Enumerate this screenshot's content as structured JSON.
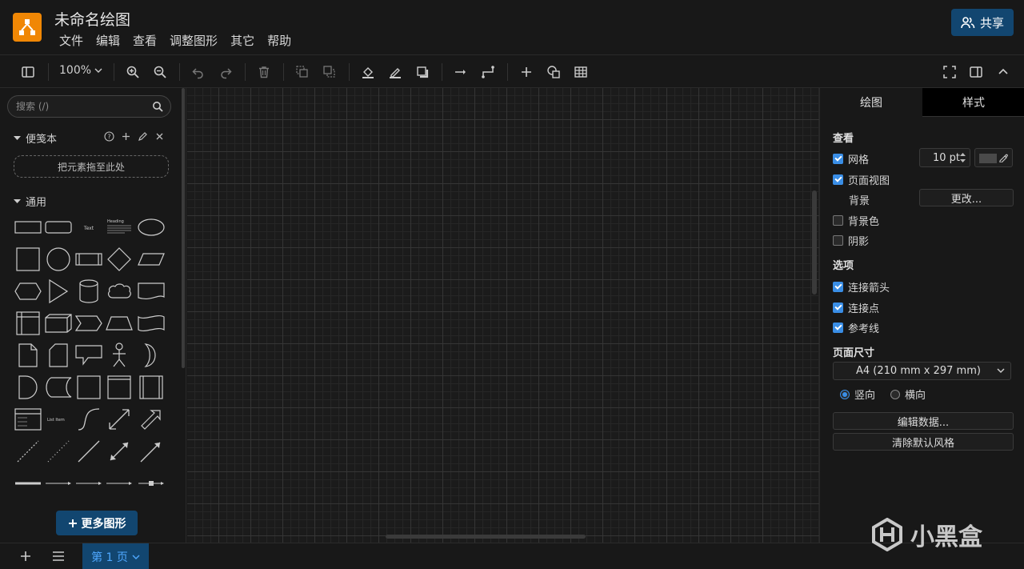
{
  "app": {
    "title": "未命名绘图",
    "share_label": "共享",
    "accent_color": "#124670",
    "logo_color": "#f08705"
  },
  "menu": [
    "文件",
    "编辑",
    "查看",
    "调整图形",
    "其它",
    "帮助"
  ],
  "toolbar": {
    "zoom_level": "100%"
  },
  "left_panel": {
    "search_placeholder": "搜索 (/)",
    "scratchpad_title": "便笺本",
    "dropzone_label": "把元素拖至此处",
    "general_title": "通用",
    "more_shapes_label": "更多图形"
  },
  "right_panel": {
    "tabs": [
      "绘图",
      "样式"
    ],
    "view_section": "查看",
    "grid_label": "网格",
    "grid_size": "10 pt",
    "page_view_label": "页面视图",
    "background_label": "背景",
    "change_button": "更改...",
    "background_color_label": "背景色",
    "shadow_label": "阴影",
    "options_section": "选项",
    "connection_arrows_label": "连接箭头",
    "connection_points_label": "连接点",
    "guides_label": "参考线",
    "paper_size_section": "页面尺寸",
    "paper_size_value": "A4 (210 mm x 297 mm)",
    "portrait_label": "竖向",
    "landscape_label": "横向",
    "edit_data_button": "编辑数据...",
    "clear_style_button": "清除默认风格"
  },
  "bottom": {
    "page_tab_label": "第 1 页"
  },
  "watermark": {
    "text": "小黑盒"
  }
}
